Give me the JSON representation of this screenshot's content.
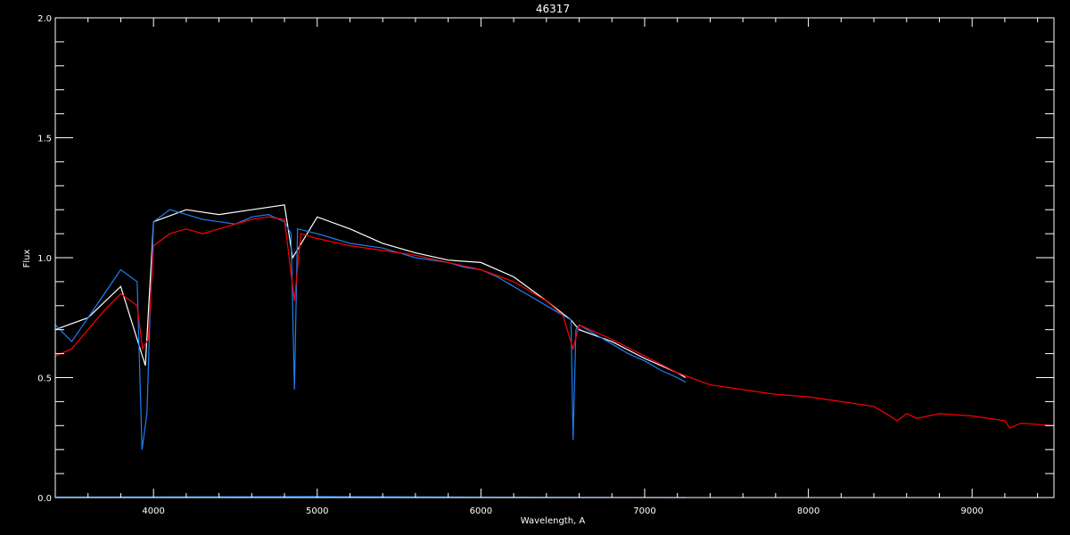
{
  "chart_data": {
    "type": "line",
    "title": "46317",
    "xlabel": "Wavelength, A",
    "ylabel": "Flux",
    "xlim": [
      3400,
      9500
    ],
    "ylim": [
      0.0,
      2.0
    ],
    "grid": false,
    "background": "#000000",
    "axis_color": "#ffffff",
    "xticks": {
      "major": [
        4000,
        5000,
        6000,
        7000,
        8000,
        9000
      ],
      "labels": [
        "4000",
        "5000",
        "6000",
        "7000",
        "8000",
        "9000"
      ]
    },
    "yticks": {
      "major": [
        0.0,
        0.5,
        1.0,
        1.5,
        2.0
      ],
      "labels": [
        "0.0",
        "0.5",
        "1.0",
        "1.5",
        "2.0"
      ]
    },
    "series": [
      {
        "color": "#ffffff",
        "x": [
          3400,
          3600,
          3800,
          3950,
          4000,
          4200,
          4400,
          4600,
          4800,
          4850,
          5000,
          5200,
          5400,
          5600,
          5800,
          6000,
          6200,
          6400,
          6550,
          6600,
          6800,
          7000,
          7200,
          7250
        ],
        "y": [
          0.7,
          0.75,
          0.88,
          0.55,
          1.15,
          1.2,
          1.18,
          1.2,
          1.22,
          1.0,
          1.17,
          1.12,
          1.06,
          1.02,
          0.99,
          0.98,
          0.92,
          0.82,
          0.74,
          0.7,
          0.65,
          0.58,
          0.52,
          0.5
        ]
      },
      {
        "color": "#1e7ff0",
        "x": [
          3400,
          3500,
          3600,
          3700,
          3800,
          3900,
          3930,
          3960,
          3980,
          4000,
          4100,
          4200,
          4300,
          4400,
          4500,
          4600,
          4700,
          4800,
          4840,
          4861,
          4880,
          5000,
          5100,
          5200,
          5300,
          5400,
          5500,
          5600,
          5700,
          5800,
          5900,
          6000,
          6100,
          6200,
          6300,
          6400,
          6500,
          6550,
          6563,
          6580,
          6600,
          6700,
          6800,
          6900,
          7000,
          7100,
          7200,
          7250
        ],
        "y": [
          0.72,
          0.65,
          0.75,
          0.85,
          0.95,
          0.9,
          0.2,
          0.35,
          0.8,
          1.15,
          1.2,
          1.18,
          1.16,
          1.15,
          1.14,
          1.17,
          1.18,
          1.15,
          1.1,
          0.45,
          1.12,
          1.1,
          1.08,
          1.06,
          1.05,
          1.04,
          1.02,
          1.0,
          0.99,
          0.98,
          0.96,
          0.95,
          0.92,
          0.88,
          0.84,
          0.8,
          0.76,
          0.74,
          0.24,
          0.7,
          0.72,
          0.68,
          0.64,
          0.6,
          0.57,
          0.53,
          0.5,
          0.48
        ]
      },
      {
        "color": "#ff0000",
        "x": [
          3400,
          3500,
          3600,
          3700,
          3800,
          3900,
          3933,
          3968,
          4000,
          4100,
          4200,
          4300,
          4400,
          4500,
          4600,
          4700,
          4800,
          4861,
          4900,
          5000,
          5200,
          5400,
          5600,
          5800,
          6000,
          6200,
          6400,
          6500,
          6563,
          6600,
          6800,
          7000,
          7200,
          7400,
          7600,
          7800,
          8000,
          8200,
          8400,
          8498,
          8542,
          8600,
          8662,
          8800,
          9000,
          9200,
          9230,
          9300,
          9500
        ],
        "y": [
          0.59,
          0.62,
          0.7,
          0.78,
          0.85,
          0.8,
          0.62,
          0.66,
          1.05,
          1.1,
          1.12,
          1.1,
          1.12,
          1.14,
          1.16,
          1.17,
          1.16,
          0.82,
          1.1,
          1.08,
          1.05,
          1.03,
          1.01,
          0.98,
          0.95,
          0.9,
          0.82,
          0.76,
          0.62,
          0.72,
          0.66,
          0.59,
          0.52,
          0.47,
          0.45,
          0.43,
          0.42,
          0.4,
          0.38,
          0.34,
          0.32,
          0.35,
          0.33,
          0.35,
          0.34,
          0.32,
          0.29,
          0.31,
          0.3
        ]
      },
      {
        "color": "#1e7ff0",
        "x": [
          3400,
          5000,
          6000,
          7250
        ],
        "y": [
          0.002,
          0.004,
          0.002,
          0.0
        ]
      }
    ]
  }
}
